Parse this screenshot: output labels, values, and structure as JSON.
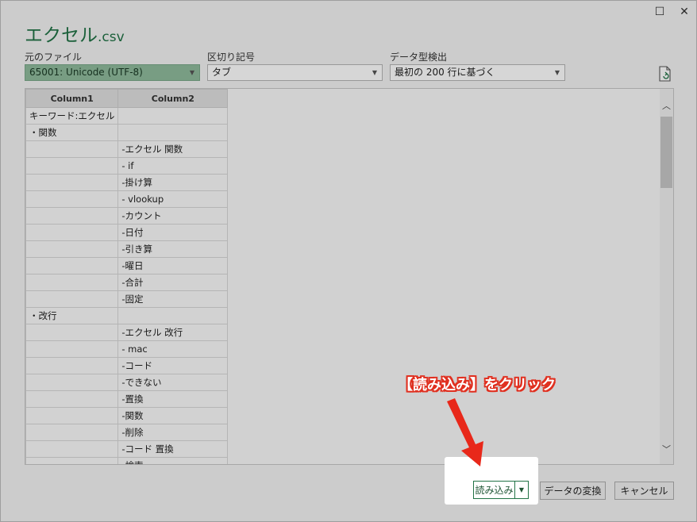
{
  "window": {
    "maximize_glyph": "☐",
    "close_glyph": "✕"
  },
  "title": {
    "name": "エクセル",
    "ext": ".csv"
  },
  "source_file": {
    "label": "元のファイル",
    "value": "65001: Unicode (UTF-8)"
  },
  "delimiter": {
    "label": "区切り記号",
    "value": "タブ"
  },
  "type_detection": {
    "label": "データ型検出",
    "value": "最初の 200 行に基づく"
  },
  "table": {
    "columns": [
      "Column1",
      "Column2"
    ],
    "rows": [
      [
        "キーワード:エクセル",
        ""
      ],
      [
        "・関数",
        ""
      ],
      [
        "",
        "-エクセル 関数"
      ],
      [
        "",
        "- if"
      ],
      [
        "",
        "-掛け算"
      ],
      [
        "",
        "- vlookup"
      ],
      [
        "",
        "-カウント"
      ],
      [
        "",
        "-日付"
      ],
      [
        "",
        "-引き算"
      ],
      [
        "",
        "-曜日"
      ],
      [
        "",
        "-合計"
      ],
      [
        "",
        "-固定"
      ],
      [
        "・改行",
        ""
      ],
      [
        "",
        "-エクセル 改行"
      ],
      [
        "",
        "- mac"
      ],
      [
        "",
        "-コード"
      ],
      [
        "",
        "-できない"
      ],
      [
        "",
        "-置換"
      ],
      [
        "",
        "-関数"
      ],
      [
        "",
        "-削除"
      ],
      [
        "",
        "-コード 置換"
      ],
      [
        "",
        "-検索"
      ]
    ]
  },
  "buttons": {
    "load": "読み込み",
    "transform": "データの変換",
    "cancel": "キャンセル"
  },
  "annotation": "【読み込み】をクリック",
  "colors": {
    "accent": "#217346",
    "annotation": "#e03020"
  }
}
